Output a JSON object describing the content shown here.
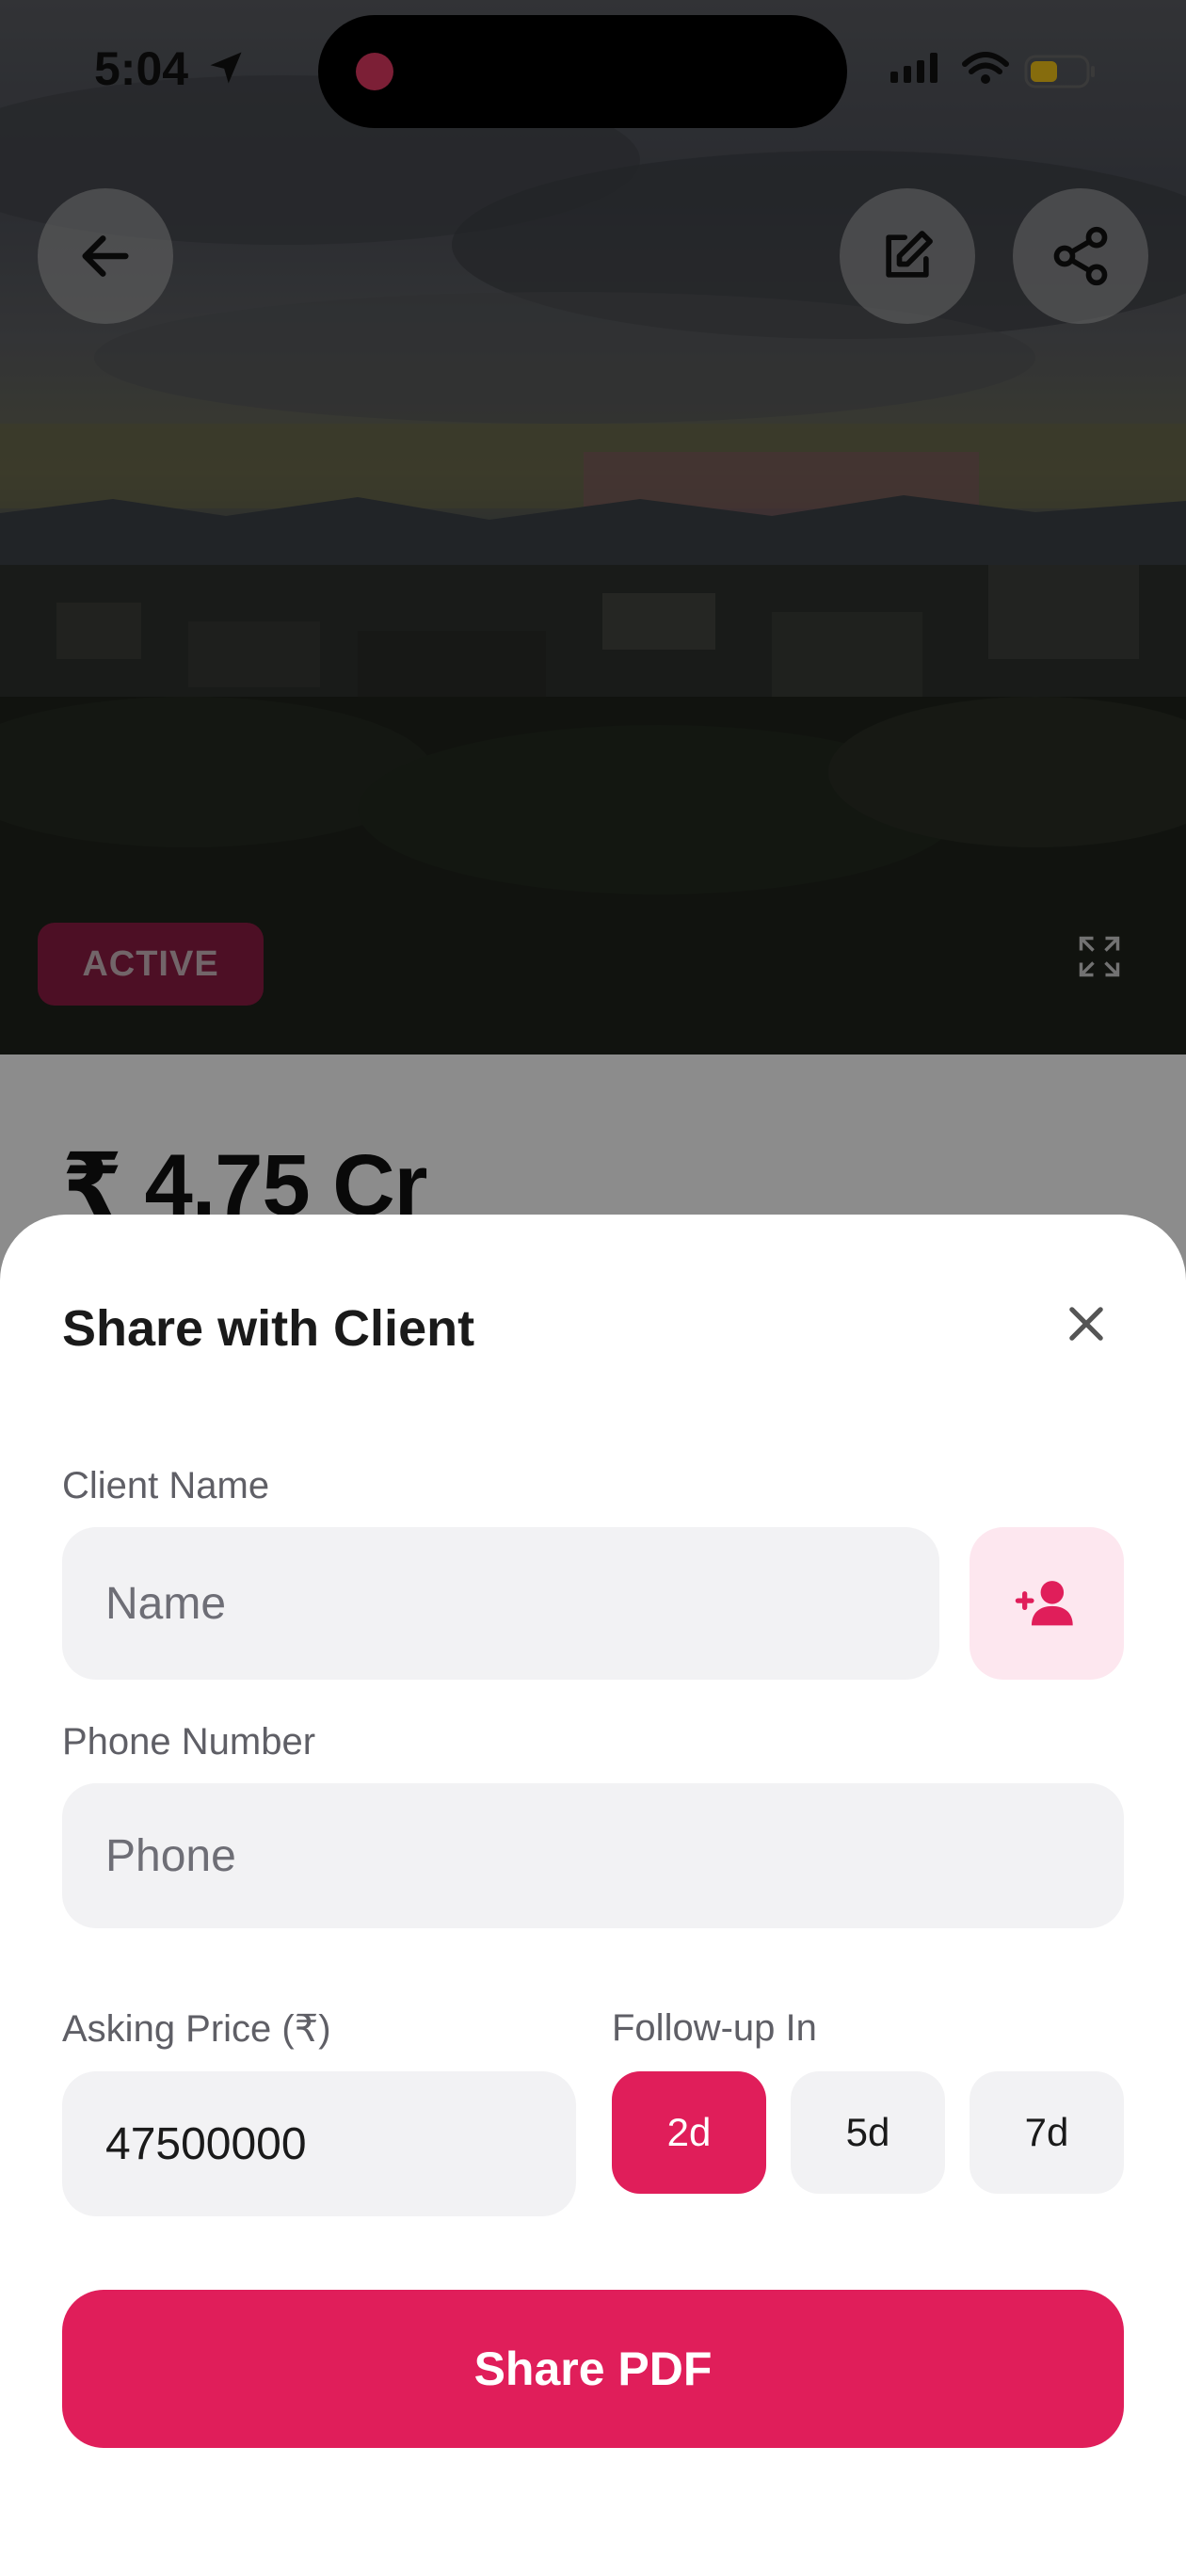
{
  "status_bar": {
    "time": "5:04"
  },
  "listing": {
    "status_badge": "ACTIVE",
    "price": "₹ 4.75 Cr"
  },
  "sheet": {
    "title": "Share with Client",
    "client_name": {
      "label": "Client Name",
      "placeholder": "Name",
      "value": ""
    },
    "phone": {
      "label": "Phone Number",
      "placeholder": "Phone",
      "value": ""
    },
    "asking_price": {
      "label": "Asking Price (₹)",
      "value": "47500000"
    },
    "follow_up": {
      "label": "Follow-up In",
      "options": [
        "2d",
        "5d",
        "7d"
      ],
      "selected": "2d"
    },
    "share_button": "Share PDF"
  },
  "colors": {
    "accent": "#e01e5a",
    "accent_light": "#fde7ef",
    "badge": "#8c1d44"
  },
  "icons": [
    "location-arrow-icon",
    "signal-icon",
    "wifi-icon",
    "battery-icon",
    "back-arrow-icon",
    "edit-icon",
    "share-icon",
    "expand-icon",
    "close-icon",
    "add-contact-icon"
  ]
}
